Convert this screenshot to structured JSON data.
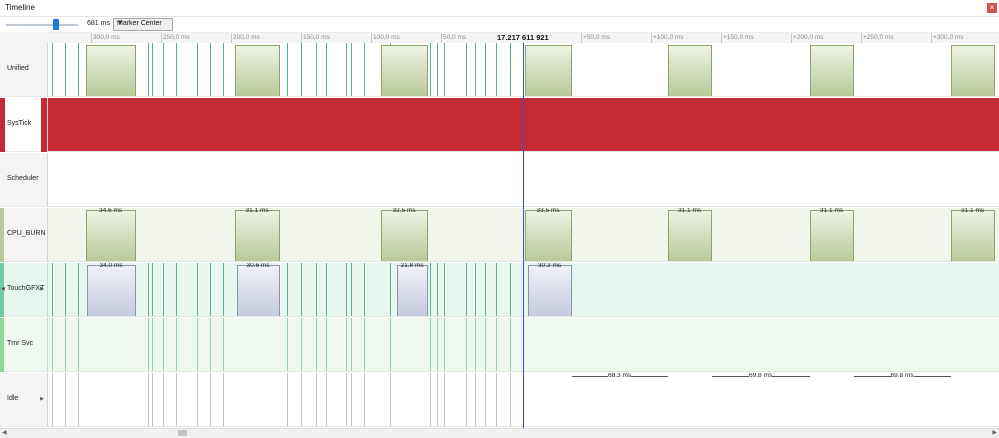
{
  "window": {
    "title": "Timeline",
    "close_label": "×"
  },
  "toolbar": {
    "zoom_value": "681 ms",
    "mode": "Marker Center"
  },
  "cursor": {
    "time": "17.217 611 921"
  },
  "ruler": {
    "ticks": [
      "300,0 ms",
      "250,0 ms",
      "200,0 ms",
      "150,0 ms",
      "100,0 ms",
      "50,0 ms",
      "+50,0 ms",
      "+100,0 ms",
      "+150,0 ms",
      "+200,0 ms",
      "+250,0 ms",
      "+300,0 ms"
    ]
  },
  "lanes": [
    {
      "name": "Unified",
      "color": "#ffffff"
    },
    {
      "name": "SysTick",
      "color": "#c42a33"
    },
    {
      "name": "Scheduler",
      "color": "#ffffff"
    },
    {
      "name": "CPU_BURN",
      "color": "#f1f5ea"
    },
    {
      "name": "TouchGFXT",
      "color": "#e8f6f0"
    },
    {
      "name": "Tmr Svc",
      "color": "#eef8ee"
    },
    {
      "name": "Idle",
      "color": "#ffffff"
    }
  ],
  "durations": {
    "cpu_burn": [
      "34.6 ms",
      "31.1 ms",
      "32.5 ms",
      "33.5 ms",
      "31.1 ms",
      "31.1 ms",
      "31.1 ms"
    ],
    "touchgfx": [
      "34.0 ms",
      "30.6 ms",
      "21.8 ms",
      "30.3 ms"
    ],
    "idle": [
      "68.3 ms",
      "69.8 ms",
      "69.8 ms"
    ]
  },
  "colors": {
    "accent": "#1f7ad6",
    "cursor": "#3a4fc4",
    "systick": "#c42a33",
    "task_green": "#b9c99a",
    "task_blue": "#c5cbdd"
  }
}
